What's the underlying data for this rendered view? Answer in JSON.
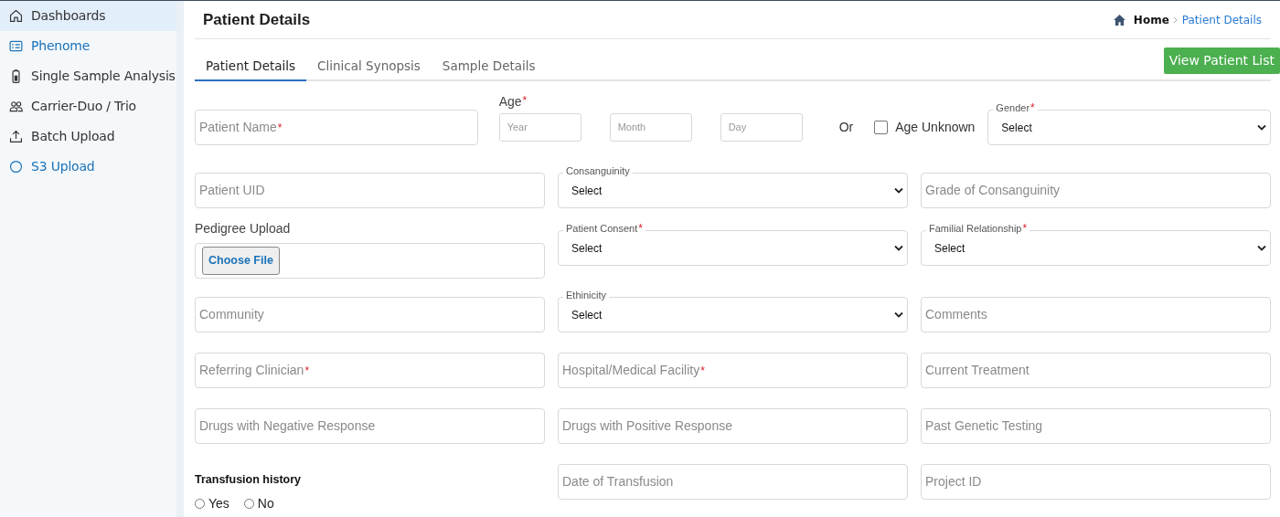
{
  "sidebar": {
    "items": [
      {
        "label": "Dashboards",
        "kind": "home",
        "selected": true,
        "highlighted": false
      },
      {
        "label": "Phenome",
        "kind": "list",
        "selected": false,
        "highlighted": true
      },
      {
        "label": "Single Sample Analysis",
        "kind": "battery",
        "selected": false,
        "highlighted": false
      },
      {
        "label": "Carrier-Duo / Trio",
        "kind": "people",
        "selected": false,
        "highlighted": false
      },
      {
        "label": "Batch Upload",
        "kind": "upload",
        "selected": false,
        "highlighted": false
      },
      {
        "label": "S3 Upload",
        "kind": "circle",
        "selected": false,
        "highlighted": true
      }
    ]
  },
  "page": {
    "title": "Patient Details",
    "breadcrumb": [
      {
        "label": "Home",
        "current": false
      },
      {
        "label": "Patient Details",
        "current": true
      }
    ]
  },
  "tabs": [
    {
      "label": "Patient Details",
      "selected": true
    },
    {
      "label": "Clinical Synopsis",
      "selected": false
    },
    {
      "label": "Sample Details",
      "selected": false
    }
  ],
  "view_button": "View Patient List",
  "form": {
    "rows": [
      [
        {
          "kind": "input",
          "placeholder": "Patient Name",
          "required": "*"
        },
        {
          "kind": "age",
          "label": "Age",
          "required": "*",
          "parts": [
            {
              "placeholder": "Year"
            },
            {
              "placeholder": "Month"
            },
            {
              "placeholder": "Day"
            }
          ],
          "or": "Or",
          "checkbox": {
            "label": "Age Unknown",
            "checked": false
          }
        },
        {
          "kind": "select",
          "label": "Gender",
          "required": "*",
          "value": "Select"
        }
      ],
      [
        {
          "kind": "input",
          "placeholder": "Patient UID"
        },
        {
          "kind": "select",
          "label": "Consanguinity",
          "value": "Select"
        },
        {
          "kind": "input",
          "placeholder": "Grade of Consanguinity"
        }
      ],
      [
        {
          "kind": "file",
          "label": "Pedigree Upload",
          "button": "Choose File"
        },
        {
          "kind": "select",
          "label": "Patient Consent",
          "required": "*",
          "value": "Select"
        },
        {
          "kind": "select",
          "label": "Familial Relationship",
          "required": "*",
          "value": "Select"
        }
      ],
      [
        {
          "kind": "input",
          "placeholder": "Community"
        },
        {
          "kind": "select",
          "label": "Ethinicity",
          "value": "Select"
        },
        {
          "kind": "input",
          "placeholder": "Comments"
        }
      ],
      [
        {
          "kind": "input",
          "placeholder": "Referring Clinician",
          "required": "*"
        },
        {
          "kind": "input",
          "placeholder": "Hospital/Medical Facility",
          "required": "*"
        },
        {
          "kind": "input",
          "placeholder": "Current Treatment"
        }
      ],
      [
        {
          "kind": "input",
          "placeholder": "Drugs with Negative Response"
        },
        {
          "kind": "input",
          "placeholder": "Drugs with Positive Response"
        },
        {
          "kind": "input",
          "placeholder": "Past Genetic Testing"
        }
      ],
      [
        {
          "kind": "radio",
          "label": "Transfusion history",
          "options": [
            {
              "label": "Yes",
              "selected": false
            },
            {
              "label": "No",
              "selected": false
            }
          ]
        },
        {
          "kind": "input",
          "placeholder": "Date of Transfusion"
        },
        {
          "kind": "input",
          "placeholder": "Project ID"
        }
      ]
    ]
  }
}
